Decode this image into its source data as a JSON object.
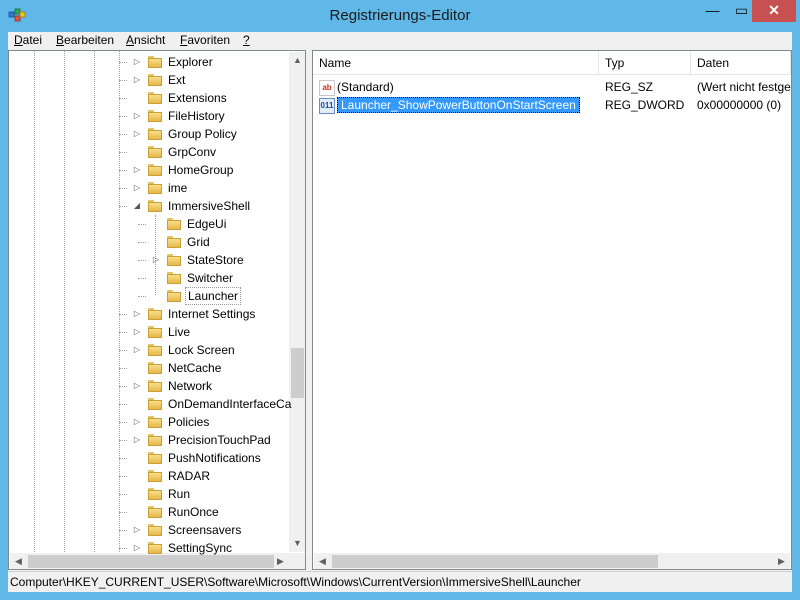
{
  "window": {
    "title": "Registrierungs-Editor",
    "minimize_glyph": "—",
    "maximize_glyph": "▭",
    "close_glyph": "✕",
    "app_icon": "regedit-icon"
  },
  "menu": [
    {
      "label": "Datei",
      "accel": "D"
    },
    {
      "label": "Bearbeiten",
      "accel": "B"
    },
    {
      "label": "Ansicht",
      "accel": "A"
    },
    {
      "label": "Favoriten",
      "accel": "F"
    },
    {
      "label": "?",
      "accel": "?"
    }
  ],
  "tree": {
    "items": [
      {
        "label": "Explorer",
        "expander": "▷",
        "level": 1
      },
      {
        "label": "Ext",
        "expander": "▷",
        "level": 1
      },
      {
        "label": "Extensions",
        "expander": "",
        "level": 1
      },
      {
        "label": "FileHistory",
        "expander": "▷",
        "level": 1
      },
      {
        "label": "Group Policy",
        "expander": "▷",
        "level": 1
      },
      {
        "label": "GrpConv",
        "expander": "",
        "level": 1
      },
      {
        "label": "HomeGroup",
        "expander": "▷",
        "level": 1
      },
      {
        "label": "ime",
        "expander": "▷",
        "level": 1
      },
      {
        "label": "ImmersiveShell",
        "expander": "◢",
        "level": 1
      },
      {
        "label": "EdgeUi",
        "expander": "",
        "level": 2
      },
      {
        "label": "Grid",
        "expander": "",
        "level": 2
      },
      {
        "label": "StateStore",
        "expander": "▷",
        "level": 2
      },
      {
        "label": "Switcher",
        "expander": "",
        "level": 2
      },
      {
        "label": "Launcher",
        "expander": "",
        "level": 2,
        "selected": true
      },
      {
        "label": "Internet Settings",
        "expander": "▷",
        "level": 1
      },
      {
        "label": "Live",
        "expander": "▷",
        "level": 1
      },
      {
        "label": "Lock Screen",
        "expander": "▷",
        "level": 1
      },
      {
        "label": "NetCache",
        "expander": "",
        "level": 1
      },
      {
        "label": "Network",
        "expander": "▷",
        "level": 1
      },
      {
        "label": "OnDemandInterfaceCa",
        "expander": "",
        "level": 1
      },
      {
        "label": "Policies",
        "expander": "▷",
        "level": 1
      },
      {
        "label": "PrecisionTouchPad",
        "expander": "▷",
        "level": 1
      },
      {
        "label": "PushNotifications",
        "expander": "",
        "level": 1
      },
      {
        "label": "RADAR",
        "expander": "",
        "level": 1
      },
      {
        "label": "Run",
        "expander": "",
        "level": 1
      },
      {
        "label": "RunOnce",
        "expander": "",
        "level": 1
      },
      {
        "label": "Screensavers",
        "expander": "▷",
        "level": 1
      },
      {
        "label": "SettingSync",
        "expander": "▷",
        "level": 1
      }
    ]
  },
  "list": {
    "columns": [
      "Name",
      "Typ",
      "Daten"
    ],
    "rows": [
      {
        "icon": "ab",
        "name": "(Standard)",
        "type": "REG_SZ",
        "data": "(Wert nicht festgelegt)",
        "selected": false
      },
      {
        "icon": "011",
        "name": "Launcher_ShowPowerButtonOnStartScreen",
        "type": "REG_DWORD",
        "data": "0x00000000 (0)",
        "selected": true
      }
    ]
  },
  "scroll": {
    "up": "▲",
    "down": "▼",
    "left": "◀",
    "right": "▶"
  },
  "status": {
    "path": "Computer\\HKEY_CURRENT_USER\\Software\\Microsoft\\Windows\\CurrentVersion\\ImmersiveShell\\Launcher"
  },
  "colors": {
    "accent": "#5fb8e8",
    "selection": "#3399ff",
    "close": "#c75050"
  }
}
